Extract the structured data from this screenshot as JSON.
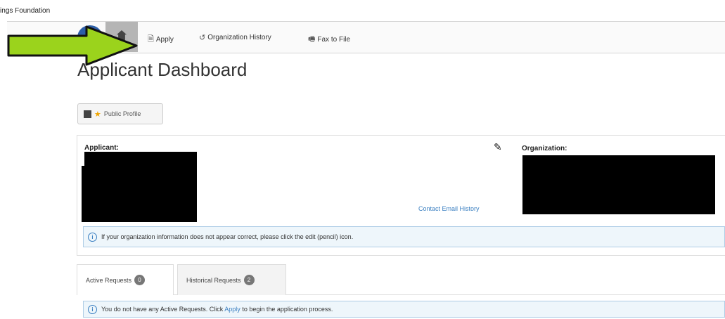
{
  "header": {
    "org_name": "ings Foundation"
  },
  "nav": {
    "apply": "Apply",
    "org_history": "Organization History",
    "fax": "Fax to File"
  },
  "page": {
    "title": "Applicant Dashboard"
  },
  "public_profile": {
    "label": "Public Profile"
  },
  "panel": {
    "applicant_label": "Applicant:",
    "organization_label": "Organization:",
    "contact_link": "Contact Email History",
    "info_text": "If your organization information does not appear correct, please click the edit (pencil) icon."
  },
  "tabs": [
    {
      "label": "Active Requests",
      "count": "0"
    },
    {
      "label": "Historical Requests",
      "count": "2"
    }
  ],
  "active_info": {
    "pre": "You do not have any Active Requests. Click",
    "link": "Apply",
    "post": "to begin the application process."
  },
  "colors": {
    "accent_link": "#3a7fc1",
    "arrow": "#9bd31c",
    "logo": "#2d5fa8"
  }
}
